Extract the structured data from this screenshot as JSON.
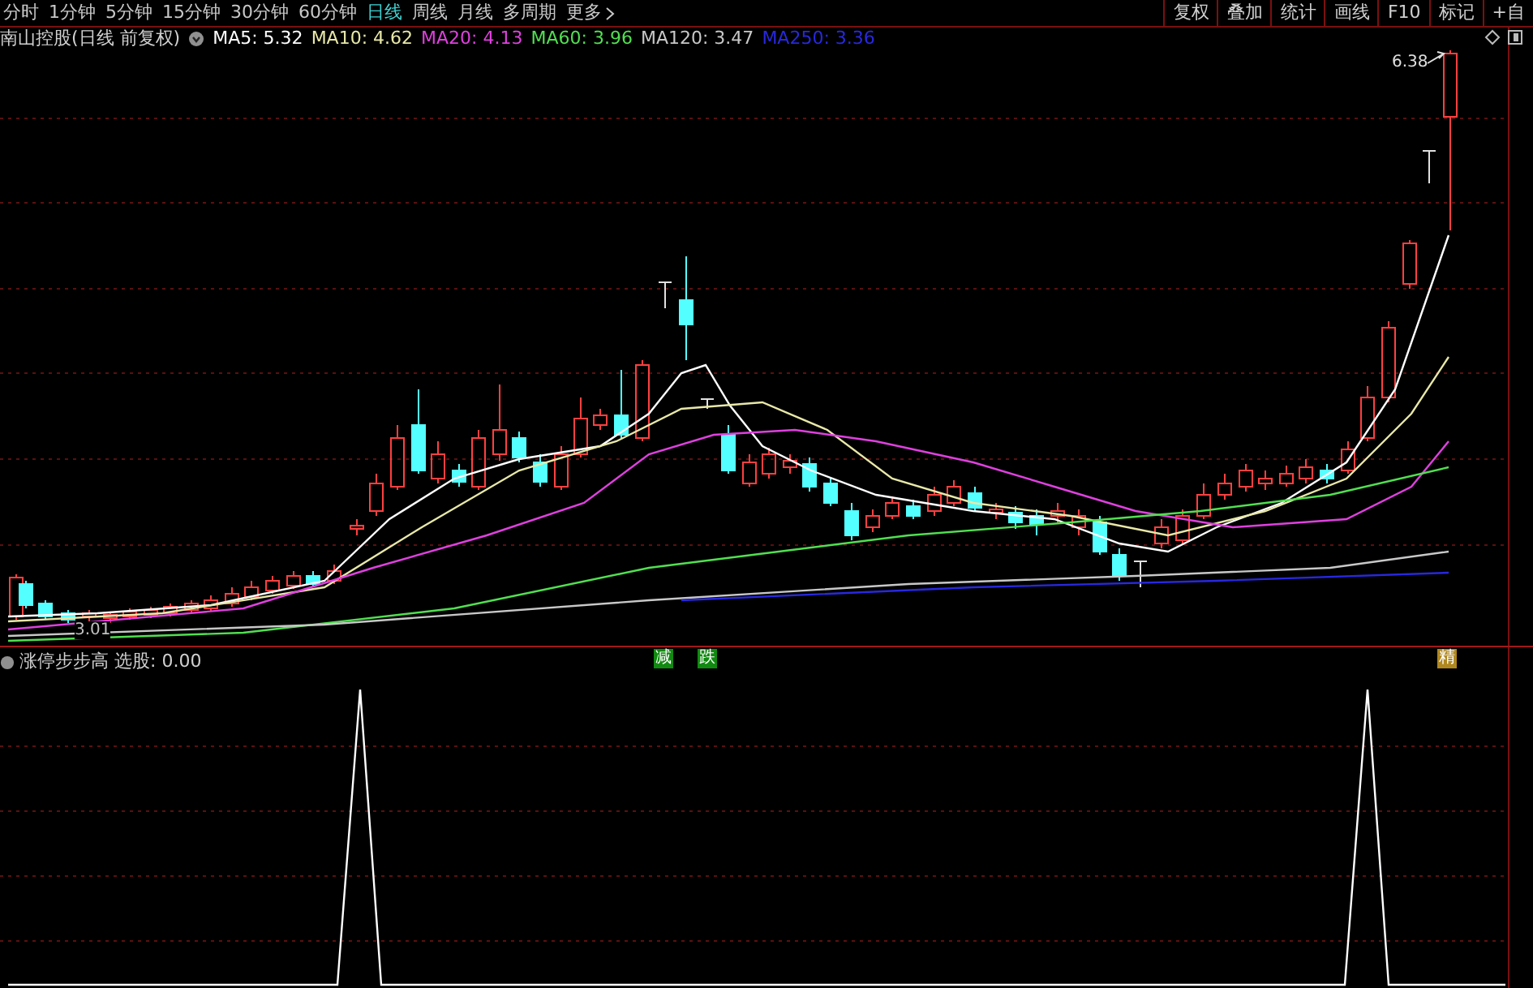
{
  "toolbar": {
    "tabs": [
      {
        "label": "分时",
        "selected": false
      },
      {
        "label": "1分钟",
        "selected": false
      },
      {
        "label": "5分钟",
        "selected": false
      },
      {
        "label": "15分钟",
        "selected": false
      },
      {
        "label": "30分钟",
        "selected": false
      },
      {
        "label": "60分钟",
        "selected": false
      },
      {
        "label": "日线",
        "selected": true
      },
      {
        "label": "周线",
        "selected": false
      },
      {
        "label": "月线",
        "selected": false
      },
      {
        "label": "多周期",
        "selected": false
      },
      {
        "label": "更多",
        "selected": false
      }
    ],
    "buttons": [
      "复权",
      "叠加",
      "统计",
      "画线",
      "F10",
      "标记",
      "+自"
    ]
  },
  "price_chart": {
    "title": "南山控股(日线 前复权)",
    "legend": [
      {
        "label": "MA5: 5.32",
        "color": "#ffffff"
      },
      {
        "label": "MA10: 4.62",
        "color": "#e8e8a8"
      },
      {
        "label": "MA20: 4.13",
        "color": "#e040e0"
      },
      {
        "label": "MA60: 3.96",
        "color": "#50e050"
      },
      {
        "label": "MA120: 3.47",
        "color": "#c8c8c8"
      },
      {
        "label": "MA250: 3.36",
        "color": "#2828e0"
      }
    ],
    "high_label": "6.38",
    "low_label": "3.01",
    "signals": [
      {
        "text": "减",
        "color": "#108a10"
      },
      {
        "text": "跌",
        "color": "#108a10"
      },
      {
        "text": "精",
        "color": "#b08820"
      }
    ]
  },
  "indicator": {
    "legend": "涨停步步高 选股: 0.00"
  }
}
